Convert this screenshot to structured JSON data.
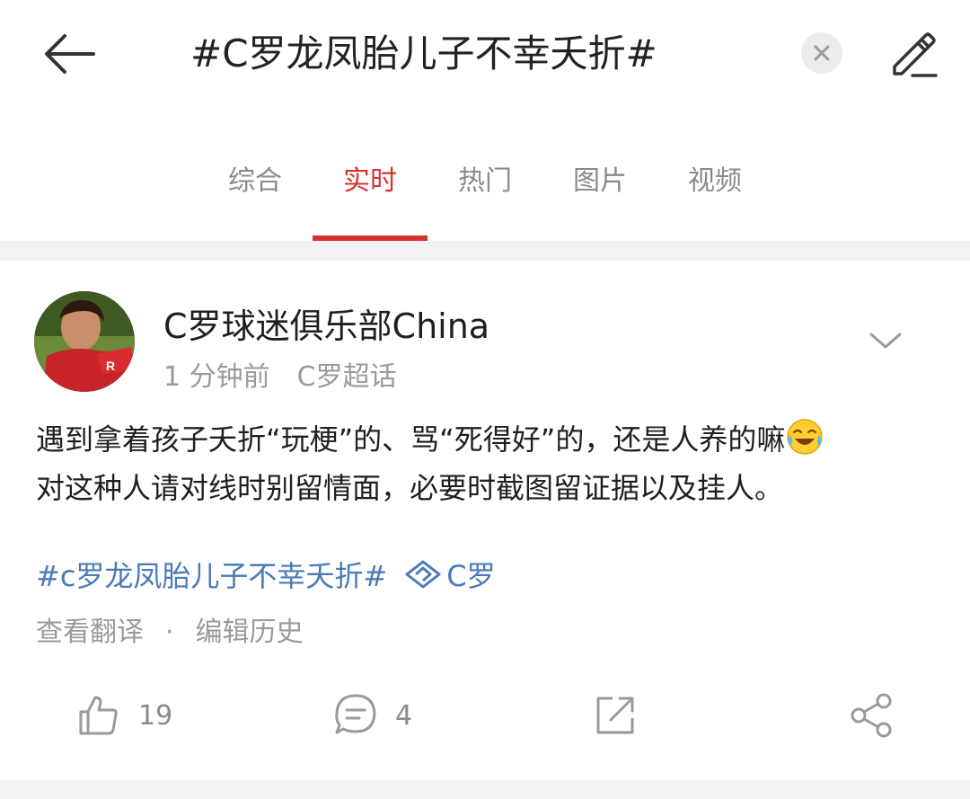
{
  "header": {
    "title": "#C罗龙凤胎儿子不幸夭折#"
  },
  "tabs": [
    {
      "label": "综合",
      "active": false
    },
    {
      "label": "实时",
      "active": true
    },
    {
      "label": "热门",
      "active": false
    },
    {
      "label": "图片",
      "active": false
    },
    {
      "label": "视频",
      "active": false
    }
  ],
  "post": {
    "username": "C罗球迷俱乐部China",
    "time": "1 分钟前",
    "source": "C罗超话",
    "line1": "遇到拿着孩子夭折“玩梗”的、骂“死得好”的，还是人养的嘛",
    "line1_emoji": "laughing-crying-emoji",
    "line2": "对这种人请对线时别留情面，必要时截图留证据以及挂人。",
    "hashtag": "#c罗龙凤胎儿子不幸夭折#",
    "topic": "C罗",
    "translate_label": "查看翻译",
    "separator": "·",
    "edit_history_label": "编辑历史",
    "likes": "19",
    "comments": "4"
  },
  "colors": {
    "accent": "#d6322f",
    "link": "#4a7ab8",
    "muted": "#9a9a9a"
  }
}
